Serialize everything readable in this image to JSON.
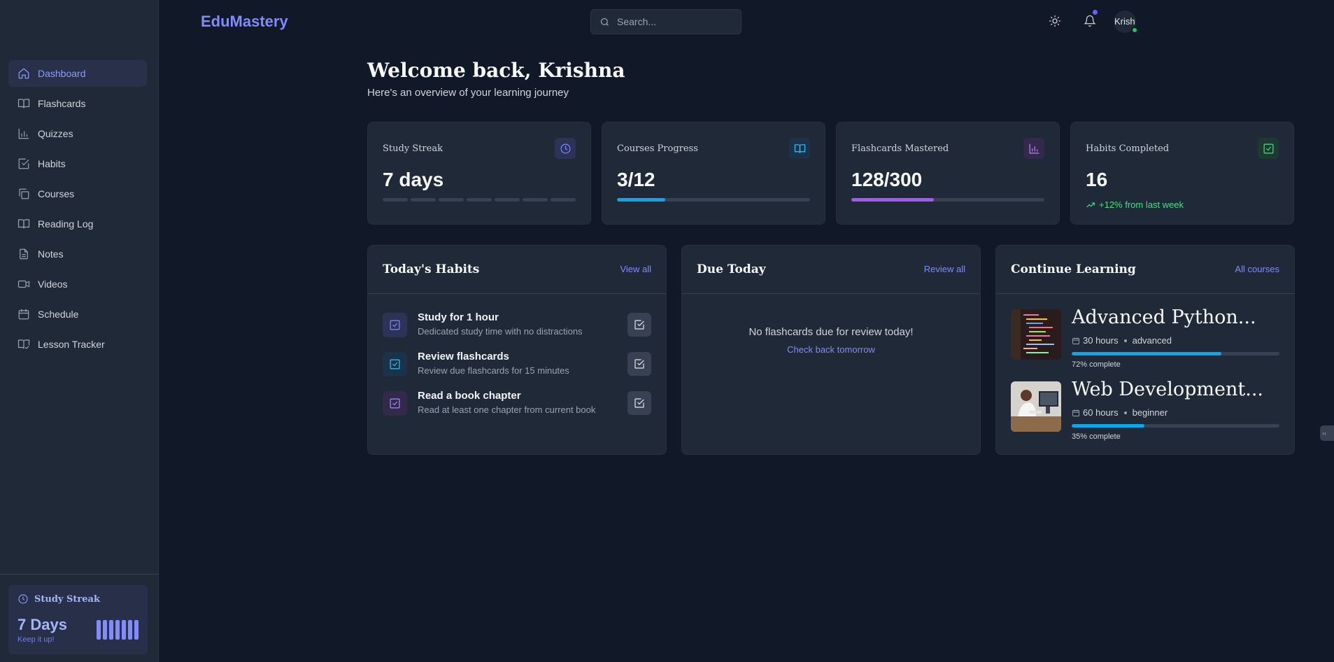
{
  "app": {
    "logo": "EduMastery"
  },
  "header": {
    "search_placeholder": "Search...",
    "avatar_text": "Krish",
    "icons": {
      "theme": "sun-icon",
      "notifications": "bell-icon"
    }
  },
  "sidebar": {
    "items": [
      {
        "label": "Dashboard",
        "icon": "home-icon",
        "active": true
      },
      {
        "label": "Flashcards",
        "icon": "book-open-icon"
      },
      {
        "label": "Quizzes",
        "icon": "bar-chart-icon"
      },
      {
        "label": "Habits",
        "icon": "check-square-icon"
      },
      {
        "label": "Courses",
        "icon": "copy-icon"
      },
      {
        "label": "Reading Log",
        "icon": "book-icon"
      },
      {
        "label": "Notes",
        "icon": "file-text-icon"
      },
      {
        "label": "Videos",
        "icon": "video-icon"
      },
      {
        "label": "Schedule",
        "icon": "calendar-icon"
      },
      {
        "label": "Lesson Tracker",
        "icon": "book-check-icon"
      }
    ],
    "streak": {
      "title": "Study Streak",
      "value": "7 Days",
      "subtitle": "Keep it up!",
      "bars": 7
    }
  },
  "welcome": {
    "title": "Welcome back, Krishna",
    "subtitle": "Here's an overview of your learning journey"
  },
  "stats": [
    {
      "label": "Study Streak",
      "value": "7 days",
      "segments": 7
    },
    {
      "label": "Courses Progress",
      "value": "3/12",
      "progress": 0.25,
      "color": "#0ea5e9"
    },
    {
      "label": "Flashcards Mastered",
      "value": "128/300",
      "progress": 0.427,
      "color": "#a855f7"
    },
    {
      "label": "Habits Completed",
      "value": "16",
      "trend": "+12% from last week"
    }
  ],
  "habits_panel": {
    "title": "Today's Habits",
    "link": "View all",
    "items": [
      {
        "title": "Study for 1 hour",
        "desc": "Dedicated study time with no distractions"
      },
      {
        "title": "Review flashcards",
        "desc": "Review due flashcards for 15 minutes"
      },
      {
        "title": "Read a book chapter",
        "desc": "Read at least one chapter from current book"
      }
    ]
  },
  "due_panel": {
    "title": "Due Today",
    "link": "Review all",
    "empty": "No flashcards due for review today!",
    "empty_link": "Check back tomorrow"
  },
  "courses_panel": {
    "title": "Continue Learning",
    "link": "All courses",
    "items": [
      {
        "title": "Advanced Python...",
        "hours": "30 hours",
        "level": "advanced",
        "progress": 0.72,
        "progress_label": "72% complete"
      },
      {
        "title": "Web Development...",
        "hours": "60 hours",
        "level": "beginner",
        "progress": 0.35,
        "progress_label": "35% complete"
      }
    ]
  },
  "edge_widget": "›‹"
}
